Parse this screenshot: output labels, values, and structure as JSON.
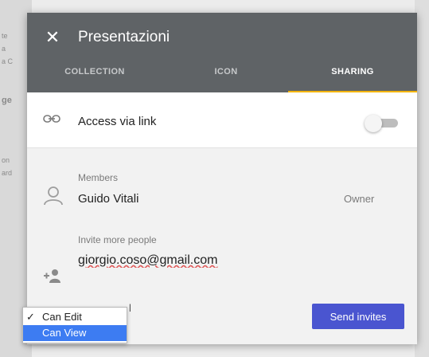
{
  "background": {
    "fragments": [
      "te",
      "a",
      "a C",
      "ge",
      "on",
      "ard"
    ]
  },
  "dialog": {
    "title": "Presentazioni",
    "close_icon": "close-icon",
    "tabs": [
      {
        "label": "COLLECTION",
        "active": false
      },
      {
        "label": "ICON",
        "active": false
      },
      {
        "label": "SHARING",
        "active": true
      }
    ],
    "accent_color": "#f4b400",
    "header_color": "#5f6366"
  },
  "link_access": {
    "icon": "link-icon",
    "label": "Access via link",
    "enabled": false
  },
  "members": {
    "label": "Members",
    "list": [
      {
        "icon": "avatar-icon",
        "name": "Guido Vitali",
        "role": "Owner"
      }
    ]
  },
  "invite": {
    "label": "Invite more people",
    "icon": "add-person-icon",
    "value": "giorgio.coso@gmail.com",
    "permission_fragment": "l",
    "send_label": "Send invites",
    "send_color": "#4a55d0"
  },
  "permission_dropdown": {
    "options": [
      {
        "label": "Can Edit",
        "checked": true,
        "check_mark": "✓"
      },
      {
        "label": "Can View",
        "checked": false,
        "highlighted": true,
        "check_mark": ""
      }
    ]
  }
}
